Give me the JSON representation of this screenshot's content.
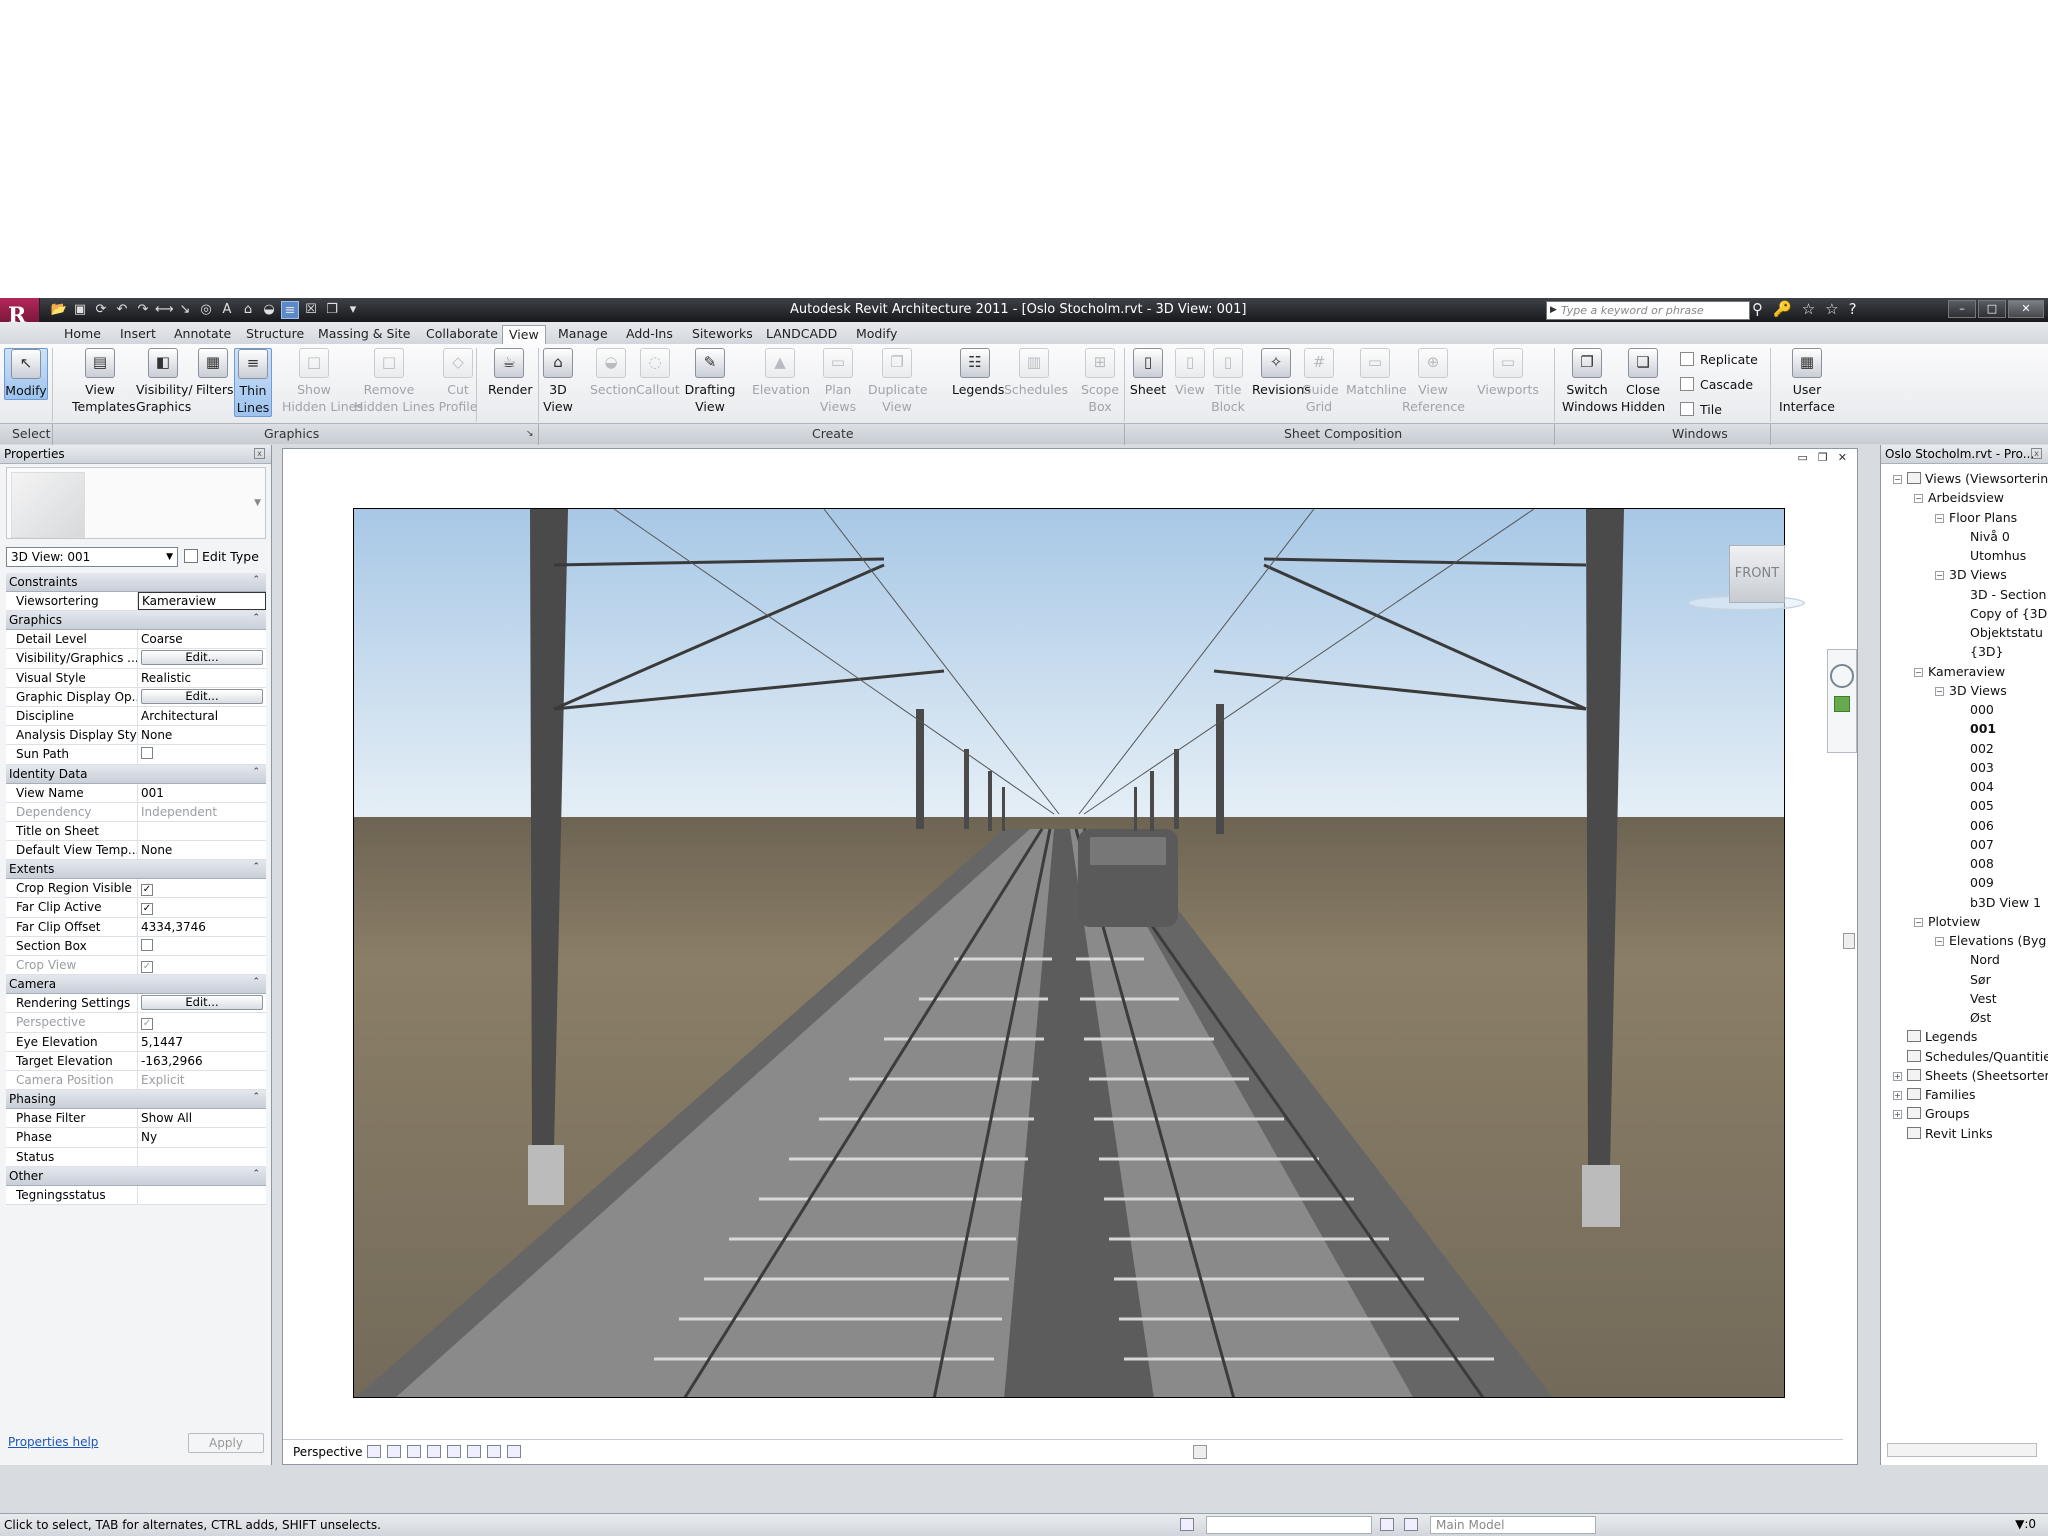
{
  "app": {
    "title": "Autodesk Revit Architecture 2011 - [Oslo Stocholm.rvt - 3D View: 001]",
    "search_placeholder": "Type a keyword or phrase"
  },
  "ribbon": {
    "tabs": [
      "Home",
      "Insert",
      "Annotate",
      "Structure",
      "Massing & Site",
      "Collaborate",
      "View",
      "Manage",
      "Add-Ins",
      "Siteworks",
      "LANDCADD",
      "Modify"
    ],
    "active_tab": "View",
    "buttons": [
      {
        "id": "modify",
        "l1": "Modify",
        "l2": "",
        "icon": "cursor-icon",
        "g": "↖",
        "dis": false,
        "sel": true
      },
      {
        "id": "view-templates",
        "l1": "View",
        "l2": "Templates",
        "icon": "view-templates-icon",
        "g": "▤",
        "dis": false
      },
      {
        "id": "visibility-graphics",
        "l1": "Visibility/",
        "l2": "Graphics",
        "icon": "visibility-graphics-icon",
        "g": "◧",
        "dis": false
      },
      {
        "id": "filters",
        "l1": "Filters",
        "l2": "",
        "icon": "filters-icon",
        "g": "▦",
        "dis": false
      },
      {
        "id": "thin-lines",
        "l1": "Thin",
        "l2": "Lines",
        "icon": "thin-lines-icon",
        "g": "≡",
        "dis": false,
        "sel": true
      },
      {
        "id": "show-hidden-lines",
        "l1": "Show",
        "l2": "Hidden Lines",
        "icon": "show-hidden-lines-icon",
        "g": "□",
        "dis": true
      },
      {
        "id": "remove-hidden-lines",
        "l1": "Remove",
        "l2": "Hidden Lines",
        "icon": "remove-hidden-lines-icon",
        "g": "□",
        "dis": true
      },
      {
        "id": "cut-profile",
        "l1": "Cut",
        "l2": "Profile",
        "icon": "cut-profile-icon",
        "g": "◇",
        "dis": true
      },
      {
        "id": "render",
        "l1": "Render",
        "l2": "",
        "icon": "teapot-icon",
        "g": "☕",
        "dis": false
      },
      {
        "id": "3d-view",
        "l1": "3D",
        "l2": "View",
        "icon": "house-3d-icon",
        "g": "⌂",
        "dis": false
      },
      {
        "id": "section",
        "l1": "Section",
        "l2": "",
        "icon": "section-icon",
        "g": "◒",
        "dis": true
      },
      {
        "id": "callout",
        "l1": "Callout",
        "l2": "",
        "icon": "callout-icon",
        "g": "◌",
        "dis": true
      },
      {
        "id": "drafting-view",
        "l1": "Drafting",
        "l2": "View",
        "icon": "drafting-view-icon",
        "g": "✎",
        "dis": false
      },
      {
        "id": "elevation",
        "l1": "Elevation",
        "l2": "",
        "icon": "elevation-icon",
        "g": "▲",
        "dis": true
      },
      {
        "id": "plan-views",
        "l1": "Plan",
        "l2": "Views",
        "icon": "plan-views-icon",
        "g": "▭",
        "dis": true
      },
      {
        "id": "duplicate-view",
        "l1": "Duplicate",
        "l2": "View",
        "icon": "duplicate-view-icon",
        "g": "❐",
        "dis": true
      },
      {
        "id": "legends",
        "l1": "Legends",
        "l2": "",
        "icon": "legends-icon",
        "g": "☷",
        "dis": false
      },
      {
        "id": "schedules",
        "l1": "Schedules",
        "l2": "",
        "icon": "schedules-icon",
        "g": "▥",
        "dis": true
      },
      {
        "id": "scope-box",
        "l1": "Scope",
        "l2": "Box",
        "icon": "scope-box-icon",
        "g": "⊞",
        "dis": true
      },
      {
        "id": "sheet",
        "l1": "Sheet",
        "l2": "",
        "icon": "sheet-icon",
        "g": "▯",
        "dis": false
      },
      {
        "id": "view",
        "l1": "View",
        "l2": "",
        "icon": "place-view-icon",
        "g": "▯",
        "dis": true
      },
      {
        "id": "title-block",
        "l1": "Title",
        "l2": "Block",
        "icon": "title-block-icon",
        "g": "▯",
        "dis": true
      },
      {
        "id": "revisions",
        "l1": "Revisions",
        "l2": "",
        "icon": "revisions-icon",
        "g": "✧",
        "dis": false
      },
      {
        "id": "guide-grid",
        "l1": "Guide",
        "l2": "Grid",
        "icon": "guide-grid-icon",
        "g": "#",
        "dis": true
      },
      {
        "id": "matchline",
        "l1": "Matchline",
        "l2": "",
        "icon": "matchline-icon",
        "g": "▭",
        "dis": true
      },
      {
        "id": "view-reference",
        "l1": "View",
        "l2": "Reference",
        "icon": "view-reference-icon",
        "g": "⊕",
        "dis": true
      },
      {
        "id": "viewports",
        "l1": "Viewports",
        "l2": "",
        "icon": "viewports-icon",
        "g": "▭",
        "dis": true
      },
      {
        "id": "switch-windows",
        "l1": "Switch",
        "l2": "Windows",
        "icon": "switch-windows-icon",
        "g": "❐",
        "dis": false
      },
      {
        "id": "close-hidden",
        "l1": "Close",
        "l2": "Hidden",
        "icon": "close-hidden-icon",
        "g": "❏",
        "dis": false
      },
      {
        "id": "user-interface",
        "l1": "User",
        "l2": "Interface",
        "icon": "user-interface-icon",
        "g": "▦",
        "dis": false
      }
    ],
    "small": {
      "replicate": "Replicate",
      "cascade": "Cascade",
      "tile": "Tile"
    },
    "panels": {
      "select": "Select",
      "graphics": "Graphics",
      "create": "Create",
      "sheet_composition": "Sheet Composition",
      "windows": "Windows"
    }
  },
  "properties": {
    "title": "Properties",
    "type_selector": "3D View: 001",
    "edit_type": "Edit Type",
    "groups": [
      {
        "name": "Constraints",
        "rows": [
          {
            "n": "Viewsortering",
            "v": "Kameraview",
            "kind": "boxed"
          }
        ]
      },
      {
        "name": "Graphics",
        "rows": [
          {
            "n": "Detail Level",
            "v": "Coarse"
          },
          {
            "n": "Visibility/Graphics ...",
            "v": "Edit...",
            "kind": "btn"
          },
          {
            "n": "Visual Style",
            "v": "Realistic"
          },
          {
            "n": "Graphic Display Op...",
            "v": "Edit...",
            "kind": "btn"
          },
          {
            "n": "Discipline",
            "v": "Architectural"
          },
          {
            "n": "Analysis Display Style",
            "v": "None"
          },
          {
            "n": "Sun Path",
            "v": "",
            "kind": "cb"
          }
        ]
      },
      {
        "name": "Identity Data",
        "rows": [
          {
            "n": "View Name",
            "v": "001"
          },
          {
            "n": "Dependency",
            "v": "Independent",
            "kind": "ro"
          },
          {
            "n": "Title on Sheet",
            "v": ""
          },
          {
            "n": "Default View Temp...",
            "v": "None"
          }
        ]
      },
      {
        "name": "Extents",
        "rows": [
          {
            "n": "Crop Region Visible",
            "v": "✓",
            "kind": "cb"
          },
          {
            "n": "Far Clip Active",
            "v": "✓",
            "kind": "cb"
          },
          {
            "n": "Far Clip Offset",
            "v": "4334,3746"
          },
          {
            "n": "Section Box",
            "v": "",
            "kind": "cb"
          },
          {
            "n": "Crop View",
            "v": "✓",
            "kind": "cbro"
          }
        ]
      },
      {
        "name": "Camera",
        "rows": [
          {
            "n": "Rendering Settings",
            "v": "Edit...",
            "kind": "btn"
          },
          {
            "n": "Perspective",
            "v": "✓",
            "kind": "cbro"
          },
          {
            "n": "Eye Elevation",
            "v": "5,1447"
          },
          {
            "n": "Target Elevation",
            "v": "-163,2966"
          },
          {
            "n": "Camera Position",
            "v": "Explicit",
            "kind": "ro"
          }
        ]
      },
      {
        "name": "Phasing",
        "rows": [
          {
            "n": "Phase Filter",
            "v": "Show All"
          },
          {
            "n": "Phase",
            "v": "Ny"
          },
          {
            "n": "Status",
            "v": ""
          }
        ]
      },
      {
        "name": "Other",
        "rows": [
          {
            "n": "Tegningsstatus",
            "v": ""
          }
        ]
      }
    ],
    "help": "Properties help",
    "apply": "Apply"
  },
  "viewport": {
    "viewcube_label": "FRONT",
    "view_control_label": "Perspective"
  },
  "project_browser": {
    "title": "Oslo Stocholm.rvt - Pro...",
    "nodes": [
      {
        "label": "Views (Viewsortering",
        "lvl": 0,
        "t": "-",
        "icon": true
      },
      {
        "label": "Arbeidsview",
        "lvl": 1,
        "t": "-"
      },
      {
        "label": "Floor Plans",
        "lvl": 2,
        "t": "-"
      },
      {
        "label": "Nivå 0",
        "lvl": 3
      },
      {
        "label": "Utomhus",
        "lvl": 3
      },
      {
        "label": "3D Views",
        "lvl": 2,
        "t": "-"
      },
      {
        "label": "3D - Section",
        "lvl": 3
      },
      {
        "label": "Copy of {3D",
        "lvl": 3
      },
      {
        "label": "Objektstatu",
        "lvl": 3
      },
      {
        "label": "{3D}",
        "lvl": 3
      },
      {
        "label": "Kameraview",
        "lvl": 1,
        "t": "-"
      },
      {
        "label": "3D Views",
        "lvl": 2,
        "t": "-"
      },
      {
        "label": "000",
        "lvl": 3
      },
      {
        "label": "001",
        "lvl": 3,
        "bold": true
      },
      {
        "label": "002",
        "lvl": 3
      },
      {
        "label": "003",
        "lvl": 3
      },
      {
        "label": "004",
        "lvl": 3
      },
      {
        "label": "005",
        "lvl": 3
      },
      {
        "label": "006",
        "lvl": 3
      },
      {
        "label": "007",
        "lvl": 3
      },
      {
        "label": "008",
        "lvl": 3
      },
      {
        "label": "009",
        "lvl": 3
      },
      {
        "label": "b3D View 1",
        "lvl": 3
      },
      {
        "label": "Plotview",
        "lvl": 1,
        "t": "-"
      },
      {
        "label": "Elevations (Byg",
        "lvl": 2,
        "t": "-"
      },
      {
        "label": "Nord",
        "lvl": 3
      },
      {
        "label": "Sør",
        "lvl": 3
      },
      {
        "label": "Vest",
        "lvl": 3
      },
      {
        "label": "Øst",
        "lvl": 3
      },
      {
        "label": "Legends",
        "lvl": 0,
        "icon": true
      },
      {
        "label": "Schedules/Quantitie",
        "lvl": 0,
        "icon": true
      },
      {
        "label": "Sheets (Sheetsorteri",
        "lvl": 0,
        "t": "+",
        "icon": true
      },
      {
        "label": "Families",
        "lvl": 0,
        "t": "+",
        "icon": true
      },
      {
        "label": "Groups",
        "lvl": 0,
        "t": "+",
        "icon": true
      },
      {
        "label": "Revit Links",
        "lvl": 0,
        "icon": true
      }
    ]
  },
  "status": {
    "text": "Click to select, TAB for alternates, CTRL adds, SHIFT unselects.",
    "model": "Main Model",
    "filter": ":0"
  }
}
